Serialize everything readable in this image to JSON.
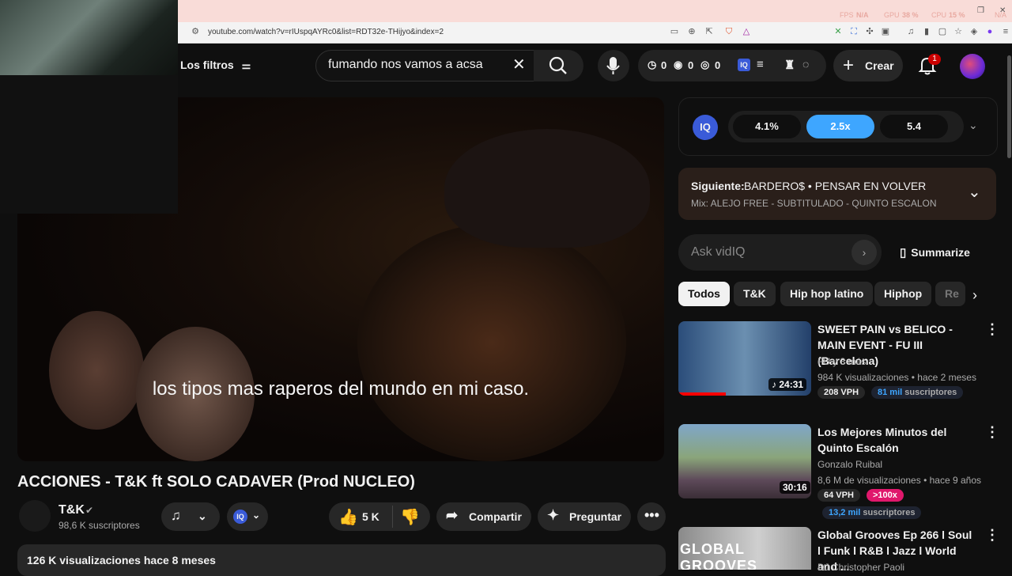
{
  "browser": {
    "url": "youtube.com/watch?v=rIUspqAYRc0&list=RDT32e-THijyo&index=2",
    "perf_fps": "FPS",
    "perf_fps_val": "N/A",
    "perf_gpu": "GPU",
    "perf_gpu_val": "38 %",
    "perf_cpu": "CPU",
    "perf_cpu_val": "15 %",
    "perf_ext": "N/A"
  },
  "masthead": {
    "filters_label": "Los filtros",
    "search_value": "fumando nos vamos a acsa",
    "stat1": "0",
    "stat2": "0",
    "stat3": "0",
    "create_label": "Crear",
    "notif_count": "1"
  },
  "video": {
    "subtitle": "los tipos mas raperos del mundo en mi caso.",
    "title": "ACCIONES - T&K ft SOLO CADAVER (Prod NUCLEO)",
    "channel": "T&K",
    "subscribers": "98,6 K suscriptores",
    "likes": "5 K",
    "share_label": "Compartir",
    "ask_label": "Preguntar",
    "views_line": "126 K visualizaciones  hace 8 meses"
  },
  "vidiq": {
    "stat_a": "4.1%",
    "stat_b": "2.5x",
    "stat_c": "5.4",
    "next_label": "Siguiente:",
    "next_title": "BARDERO$ • PENSAR EN VOLVER",
    "next_mix": "Mix: ALEJO FREE - SUBTITULADO - QUINTO ESCALON",
    "ask_placeholder": "Ask vidIQ",
    "summarize_label": "Summarize"
  },
  "chips": [
    "Todos",
    "T&K",
    "Hip hop latino",
    "Hiphop",
    "Re"
  ],
  "recommendations": [
    {
      "title": "SWEET PAIN vs BELICO - MAIN EVENT - FU III (Barcelona)",
      "channel": "FU y 3 más",
      "meta": "984 K visualizaciones • hace 2 meses",
      "duration": "24:31",
      "vph": "208 VPH",
      "subs_num": "81 mil",
      "subs_label": " suscriptores"
    },
    {
      "title": "Los Mejores Minutos del Quinto Escalón",
      "channel": "Gonzalo Ruibal",
      "meta": "8,6 M de visualizaciones • hace 9 años",
      "duration": "30:16",
      "vph": "64 VPH",
      "ratio": ">100x",
      "subs_num": "13,2 mil",
      "subs_label": " suscriptores"
    },
    {
      "title": "Global Grooves Ep 266 l Soul l Funk l R&B l Jazz l World and ...",
      "channel": "DJ Christopher Paoli",
      "thumb_text": "GLOBAL GROOVES"
    }
  ],
  "colors": {
    "accent_blue": "#3ea6ff",
    "notif_red": "#cc0000",
    "ratio_pink": "#e0186c"
  }
}
